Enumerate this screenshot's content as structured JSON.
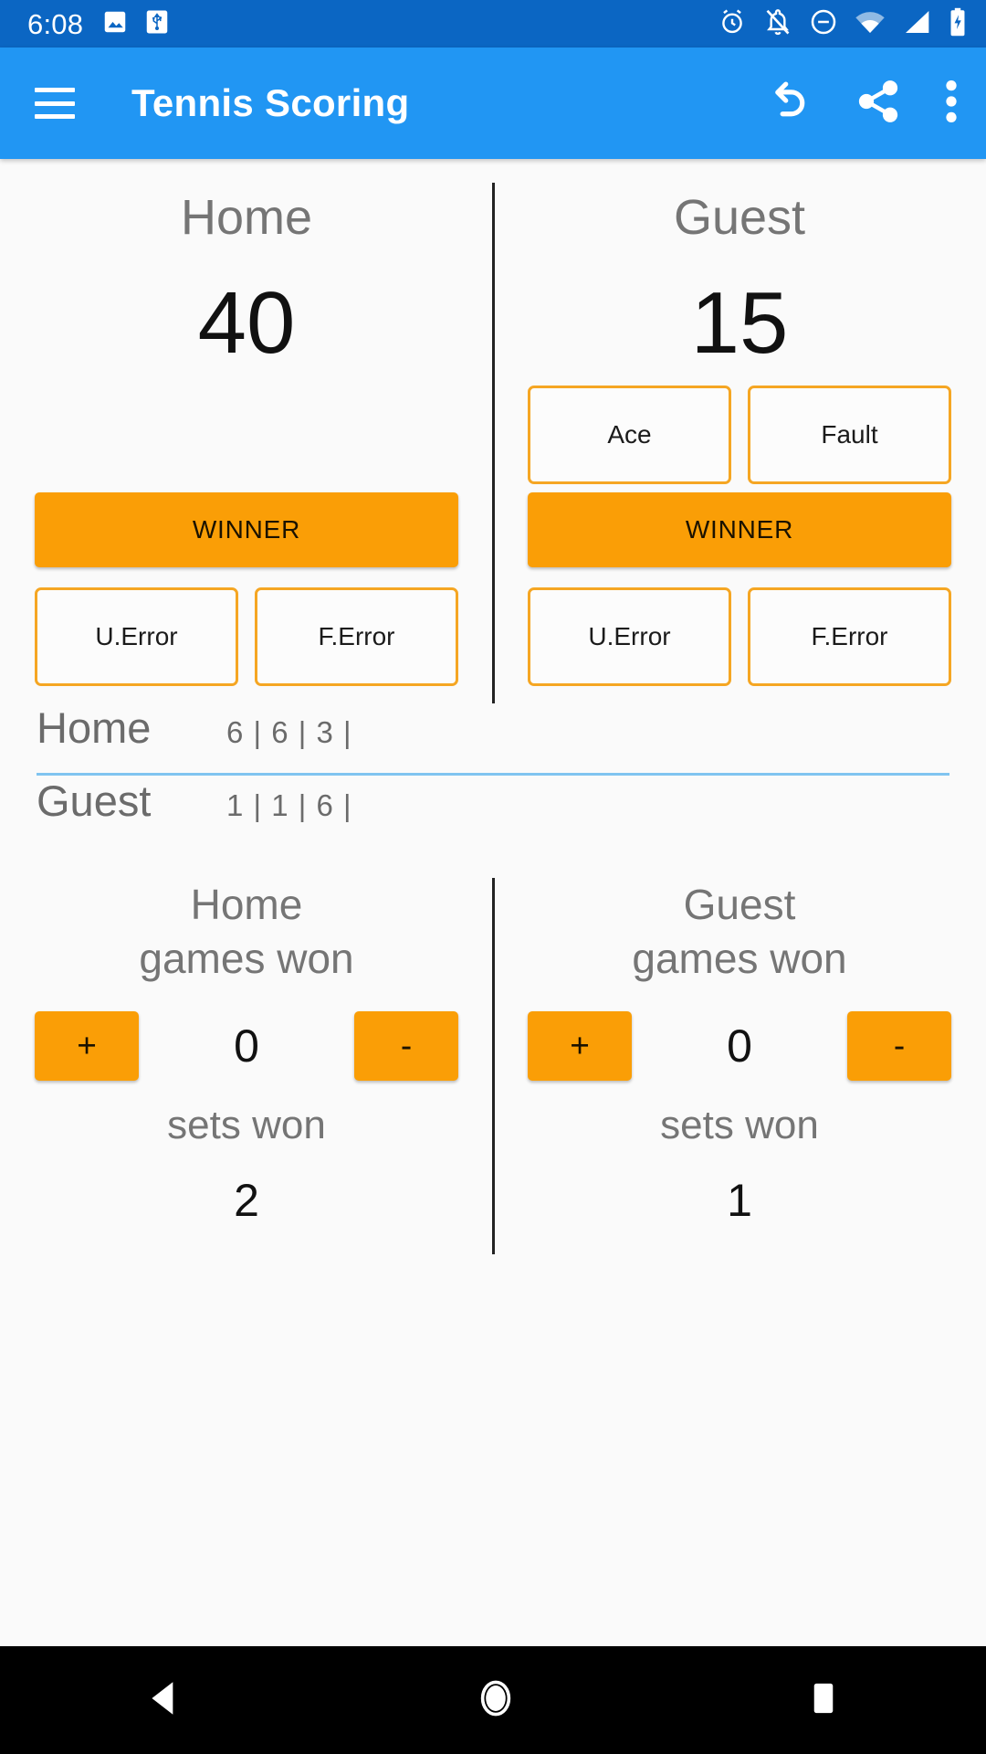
{
  "status_bar": {
    "time": "6:08",
    "left_icons": [
      "image-icon",
      "usb-icon"
    ],
    "right_icons": [
      "alarm-icon",
      "notifications-off-icon",
      "do-not-disturb-icon",
      "wifi-icon",
      "cellular-signal-icon",
      "battery-charging-icon"
    ],
    "background_color": "#0b66c3"
  },
  "app_bar": {
    "menu_icon": "hamburger-menu-icon",
    "title": "Tennis Scoring",
    "actions": [
      "undo-icon",
      "share-icon",
      "more-options-icon"
    ],
    "background_color": "#2196f3"
  },
  "scoring": {
    "accent_color": "#fa9e06",
    "outline_color": "#f5a623",
    "home": {
      "label": "Home",
      "point_score": "40",
      "winner_label": "WINNER",
      "unforced_error_label": "U.Error",
      "forced_error_label": "F.Error",
      "has_serve_buttons": false
    },
    "guest": {
      "label": "Guest",
      "point_score": "15",
      "ace_label": "Ace",
      "fault_label": "Fault",
      "winner_label": "WINNER",
      "unforced_error_label": "U.Error",
      "forced_error_label": "F.Error",
      "has_serve_buttons": true
    }
  },
  "set_scores": {
    "underline_color": "#80c4f0",
    "rows": [
      {
        "team": "Home",
        "games": "6 | 6 | 3 |"
      },
      {
        "team": "Guest",
        "games": "1 | 1 | 6 |"
      }
    ]
  },
  "stats": {
    "home": {
      "games_won_title": "Home\ngames won",
      "games_won_title_line1": "Home",
      "games_won_title_line2": "games won",
      "plus_label": "+",
      "minus_label": "-",
      "games_won_value": "0",
      "sets_won_label": "sets won",
      "sets_won_value": "2"
    },
    "guest": {
      "games_won_title_line1": "Guest",
      "games_won_title_line2": "games won",
      "plus_label": "+",
      "minus_label": "-",
      "games_won_value": "0",
      "sets_won_label": "sets won",
      "sets_won_value": "1"
    }
  },
  "nav_bar": {
    "buttons": [
      "back-icon",
      "home-icon",
      "recents-icon"
    ],
    "background_color": "#000000"
  }
}
